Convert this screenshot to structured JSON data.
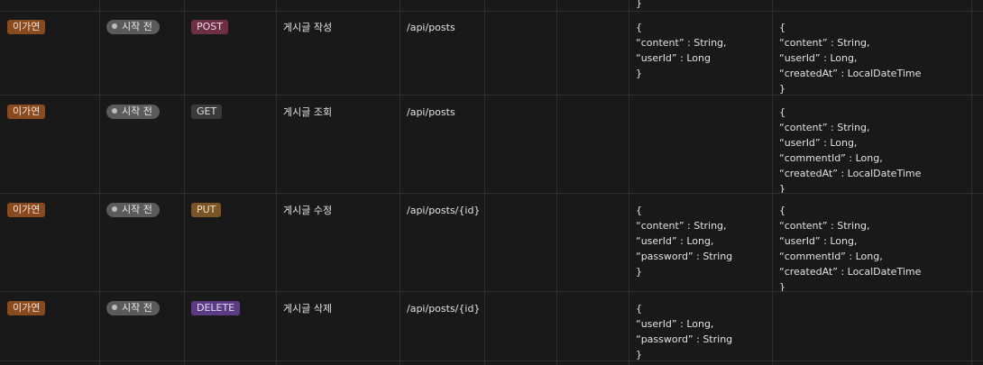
{
  "colors": {
    "background": "#191919",
    "divider": "#2e2e2e",
    "person_tag": "#8a4a1f",
    "status_tag": "#5b5b5b",
    "POST": "#6b3046",
    "GET": "#3a3a3a",
    "PUT": "#7a5527",
    "DELETE": "#5b3b82"
  },
  "top_row": {
    "json_tail": "}"
  },
  "rows": [
    {
      "person": "이가연",
      "status": "시작 전",
      "method": "POST",
      "feature": "게시글 작성",
      "url": "/api/posts",
      "request": "{\n“content” : String,\n“userId” : Long\n}",
      "response": "{\n“content” : String,\n“userId” : Long,\n“createdAt” : LocalDateTime\n}"
    },
    {
      "person": "이가연",
      "status": "시작 전",
      "method": "GET",
      "feature": "게시글 조회",
      "url": "/api/posts",
      "request": "",
      "response": "{\n“content” : String,\n“userId” : Long,\n“commentId” : Long,\n“createdAt” : LocalDateTime\n}"
    },
    {
      "person": "이가연",
      "status": "시작 전",
      "method": "PUT",
      "feature": "게시글 수정",
      "url": "/api/posts/{id}",
      "request": "{\n“content” : String,\n“userId” : Long,\n“password” : String\n}",
      "response": "{\n“content” : String,\n“userId” : Long,\n“commentId” : Long,\n“createdAt” : LocalDateTime\n}"
    },
    {
      "person": "이가연",
      "status": "시작 전",
      "method": "DELETE",
      "feature": "게시글 삭제",
      "url": "/api/posts/{id}",
      "request": "{\n“userId” : Long,\n“password” : String\n}",
      "response": ""
    }
  ]
}
